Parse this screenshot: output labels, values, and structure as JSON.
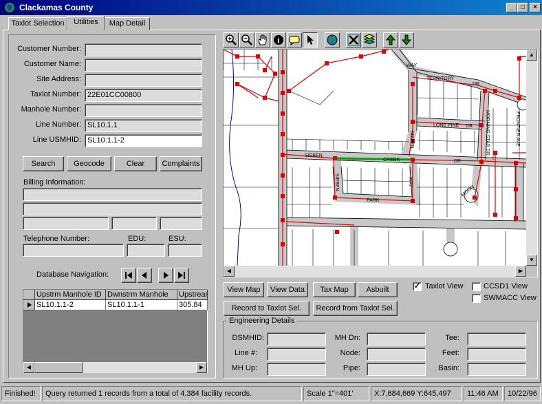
{
  "window": {
    "title": "Clackamas County"
  },
  "tabs": [
    {
      "label": "Taxlot Selection"
    },
    {
      "label": "Utilities"
    },
    {
      "label": "Map Detail"
    }
  ],
  "form": {
    "customer_number": {
      "label": "Customer Number:",
      "value": ""
    },
    "customer_name": {
      "label": "Customer Name:",
      "value": ""
    },
    "site_address": {
      "label": "Site Address:",
      "value": ""
    },
    "taxlot_number": {
      "label": "Taxlot Number:",
      "value": "22E01CC00800"
    },
    "manhole_number": {
      "label": "Manhole Number:",
      "value": ""
    },
    "line_number": {
      "label": "Line Number:",
      "value": "SL10.1.1"
    },
    "line_usmhid": {
      "label": "Line USMHID:",
      "value": "SL10.1.1-2"
    }
  },
  "buttons": {
    "search": "Search",
    "geocode": "Geocode",
    "clear": "Clear",
    "complaints": "Complaints"
  },
  "billing": {
    "label": "Billing Information:"
  },
  "phone": {
    "label": "Telephone Number:",
    "edu_label": "EDU:",
    "esu_label": "ESU:"
  },
  "db_nav": {
    "label": "Database Navigation:"
  },
  "grid": {
    "columns": [
      "Upstrm Manhole ID",
      "Dwnstrm Manhole",
      "Upstrear"
    ],
    "rows": [
      [
        "SL10.1.1-2",
        "SL10.1.1-1",
        "305.84"
      ]
    ]
  },
  "map_buttons": {
    "view_map": "View Map",
    "view_data": "View Data",
    "tax_map": "Tax Map",
    "asbuilt": "Asbuilt",
    "record_to": "Record to Taxlot Sel.",
    "record_from": "Record from Taxlot Sel."
  },
  "checkboxes": {
    "taxlot_view": {
      "label": "Taxlot View",
      "checked": true
    },
    "ccsd1_view": {
      "label": "CCSD1 View",
      "checked": false
    },
    "swmacc_view": {
      "label": "SWMACC View",
      "checked": false
    }
  },
  "engineering": {
    "title": "Engineering Details",
    "dsmhid": "DSMHID:",
    "line": "Line #:",
    "mh_up": "MH Up:",
    "mh_dn": "MH Dn:",
    "node": "Node:",
    "pipe": "Pipe:",
    "tee": "Tee:",
    "feet": "Feet:",
    "basin": "Basin:"
  },
  "map_labels": {
    "territory": "TERRITORY",
    "dr1": "DR",
    "way": "WAY",
    "lone_pine": "LONE PINE",
    "dr2": "DR",
    "morning_star": "MORNING STAR DR",
    "frontier": "FRONTIER AVE",
    "sieben": "SIEBEN",
    "creek": "CREEK",
    "dr3": "DR",
    "sieben_vert1": "SIEBEN",
    "sieben_vert2": "SIEBEN",
    "way2": "WAY",
    "park": "PARK",
    "moon": "MOON"
  },
  "status": {
    "state": "Finished!",
    "message": "Query returned 1 records from a total of 4,384 facility records.",
    "scale": "Scale 1\"=401'",
    "coords": "X:7,684,669  Y:645,497",
    "time": "11:46 AM",
    "date": "10/22/96"
  },
  "colors": {
    "title_bar": "#000080",
    "pipe_red": "#e00000",
    "selected_green": "#00a000",
    "road_gray": "#c8c8c8",
    "stream_blue": "#0000c0"
  }
}
